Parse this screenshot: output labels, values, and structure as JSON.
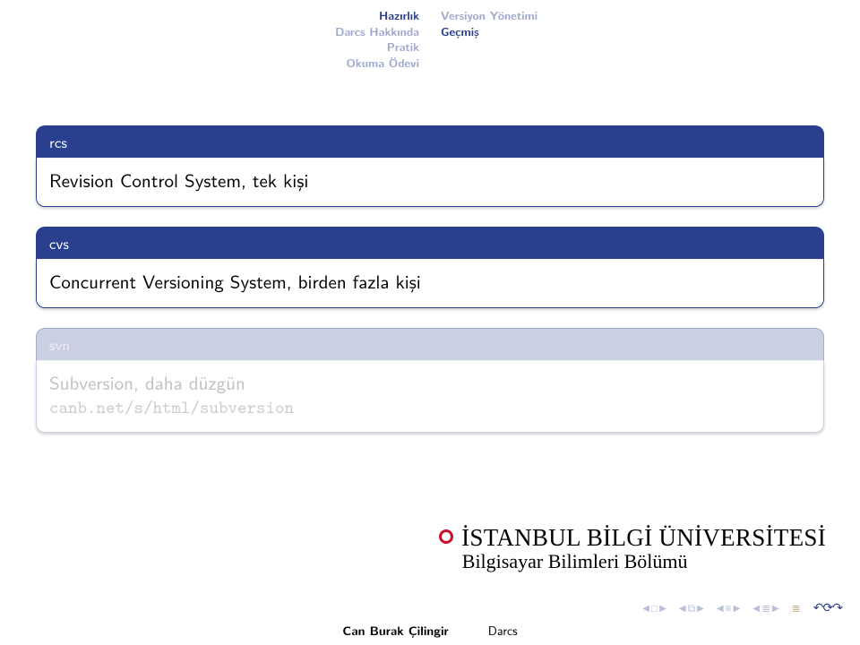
{
  "header": {
    "left": {
      "sections": [
        "Hazırlık",
        "Darcs Hakkında",
        "Pratik",
        "Okuma Ödevi"
      ],
      "active_index": 0
    },
    "right": {
      "subsections": [
        "Versiyon Yönetimi",
        "Geçmiş"
      ],
      "active_index": 1
    }
  },
  "blocks": [
    {
      "title": "rcs",
      "body": "Revision Control System, tek kişi",
      "dim": false
    },
    {
      "title": "cvs",
      "body": "Concurrent Versioning System, birden fazla kişi",
      "dim": false
    },
    {
      "title": "svn",
      "body_line1": "Subversion, daha düzgün",
      "body_line2_tt": "canb.net/s/html/subversion",
      "dim": true
    }
  ],
  "logo": {
    "line1": "İSTANBUL BİLGİ ÜNİVERSİTESİ",
    "line2": "Bilgisayar Bilimleri Bölümü"
  },
  "footer": {
    "author": "Can Burak Çilingir",
    "title": "Darcs"
  }
}
